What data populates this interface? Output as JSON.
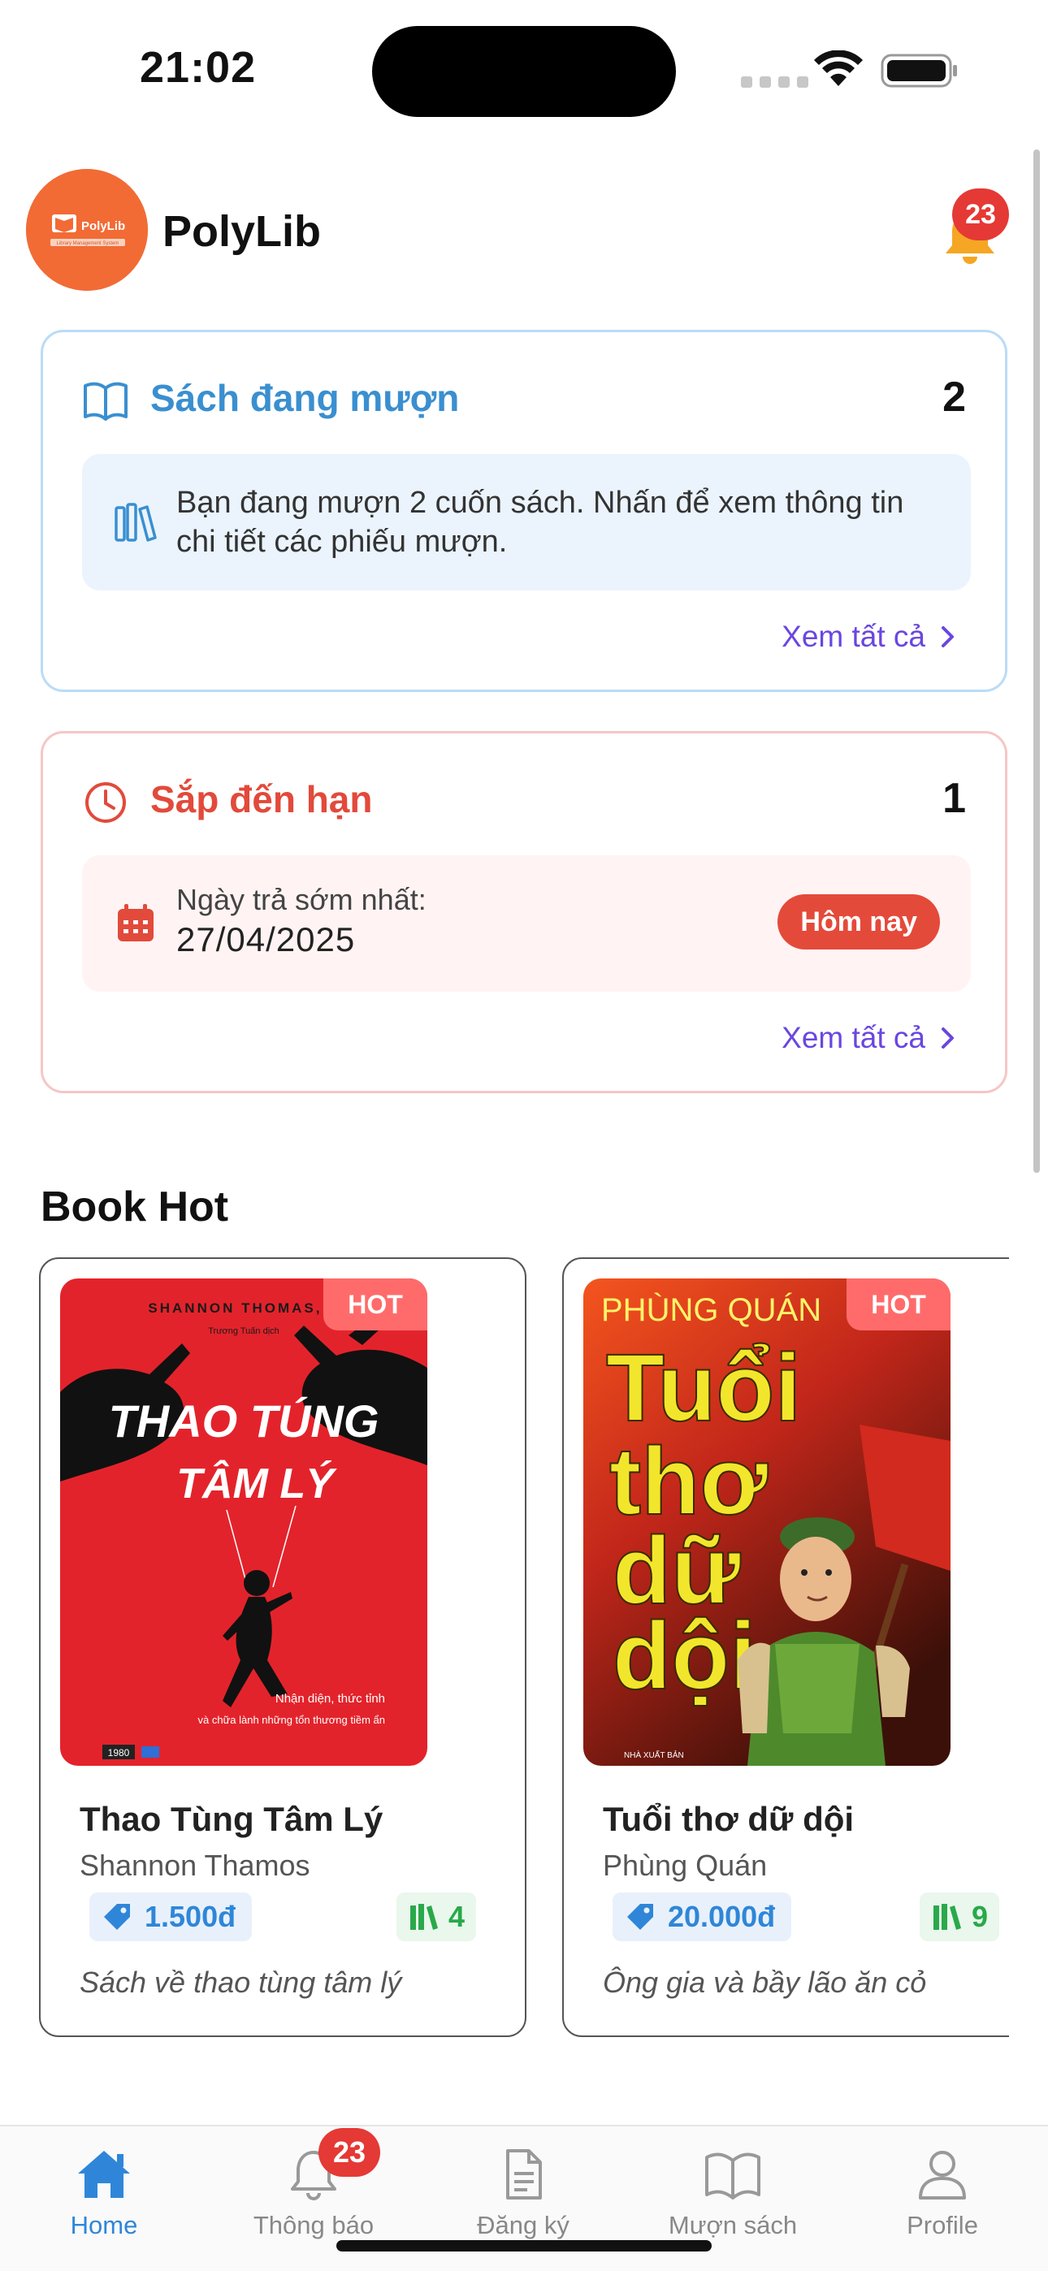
{
  "status_bar": {
    "time": "21:02"
  },
  "header": {
    "app_name": "PolyLib",
    "logo_text": "PolyLib",
    "logo_subtext": "Library Management System",
    "notification_count": "23"
  },
  "borrowing_card": {
    "title": "Sách đang mượn",
    "count": "2",
    "message": "Bạn đang mượn 2 cuốn sách. Nhấn để xem thông tin chi tiết các phiếu mượn.",
    "see_all": "Xem tất cả"
  },
  "due_card": {
    "title": "Sắp đến hạn",
    "count": "1",
    "earliest_label": "Ngày trả sớm nhất:",
    "earliest_date": "27/04/2025",
    "status_pill": "Hôm nay",
    "see_all": "Xem tất cả"
  },
  "book_hot": {
    "section_title": "Book Hot",
    "books": [
      {
        "hot_label": "HOT",
        "cover_author": "SHANNON THOMAS, L",
        "cover_translator": "Trương Tuấn dịch",
        "cover_title_line1": "THAO TÚNG",
        "cover_title_line2": "TÂM LÝ",
        "cover_tagline1": "Nhận diện, thức tỉnh",
        "cover_tagline2": "và chữa lành những tổn thương tiềm ẩn",
        "cover_publisher": "1980",
        "title": "Thao Tùng Tâm Lý",
        "author": "Shannon Thamos",
        "price": "1.500đ",
        "stock": "4",
        "description": "Sách về thao tùng tâm lý"
      },
      {
        "hot_label": "HOT",
        "cover_author": "PHÙNG QUÁN",
        "cover_title_line1": "Tuổi",
        "cover_title_line2": "thơ",
        "cover_title_line3": "dữ",
        "cover_title_line4": "dội",
        "cover_publisher": "NHÀ XUẤT BẢN",
        "title": "Tuổi thơ dữ dội",
        "author": "Phùng Quán",
        "price": "20.000đ",
        "stock": "9",
        "description": "Ông gia và bầy lão ăn cỏ"
      }
    ]
  },
  "tab_bar": {
    "tabs": [
      {
        "label": "Home",
        "icon": "home-icon",
        "active": true
      },
      {
        "label": "Thông báo",
        "icon": "bell-icon",
        "badge": "23"
      },
      {
        "label": "Đăng ký",
        "icon": "document-icon"
      },
      {
        "label": "Mượn sách",
        "icon": "open-book-icon"
      },
      {
        "label": "Profile",
        "icon": "person-icon"
      }
    ]
  },
  "colors": {
    "primary_blue": "#3a8fd0",
    "danger_red": "#e24a3b",
    "link_purple": "#6a46e0",
    "hot_tag": "#ff6b6b",
    "logo_orange": "#f26b35"
  }
}
